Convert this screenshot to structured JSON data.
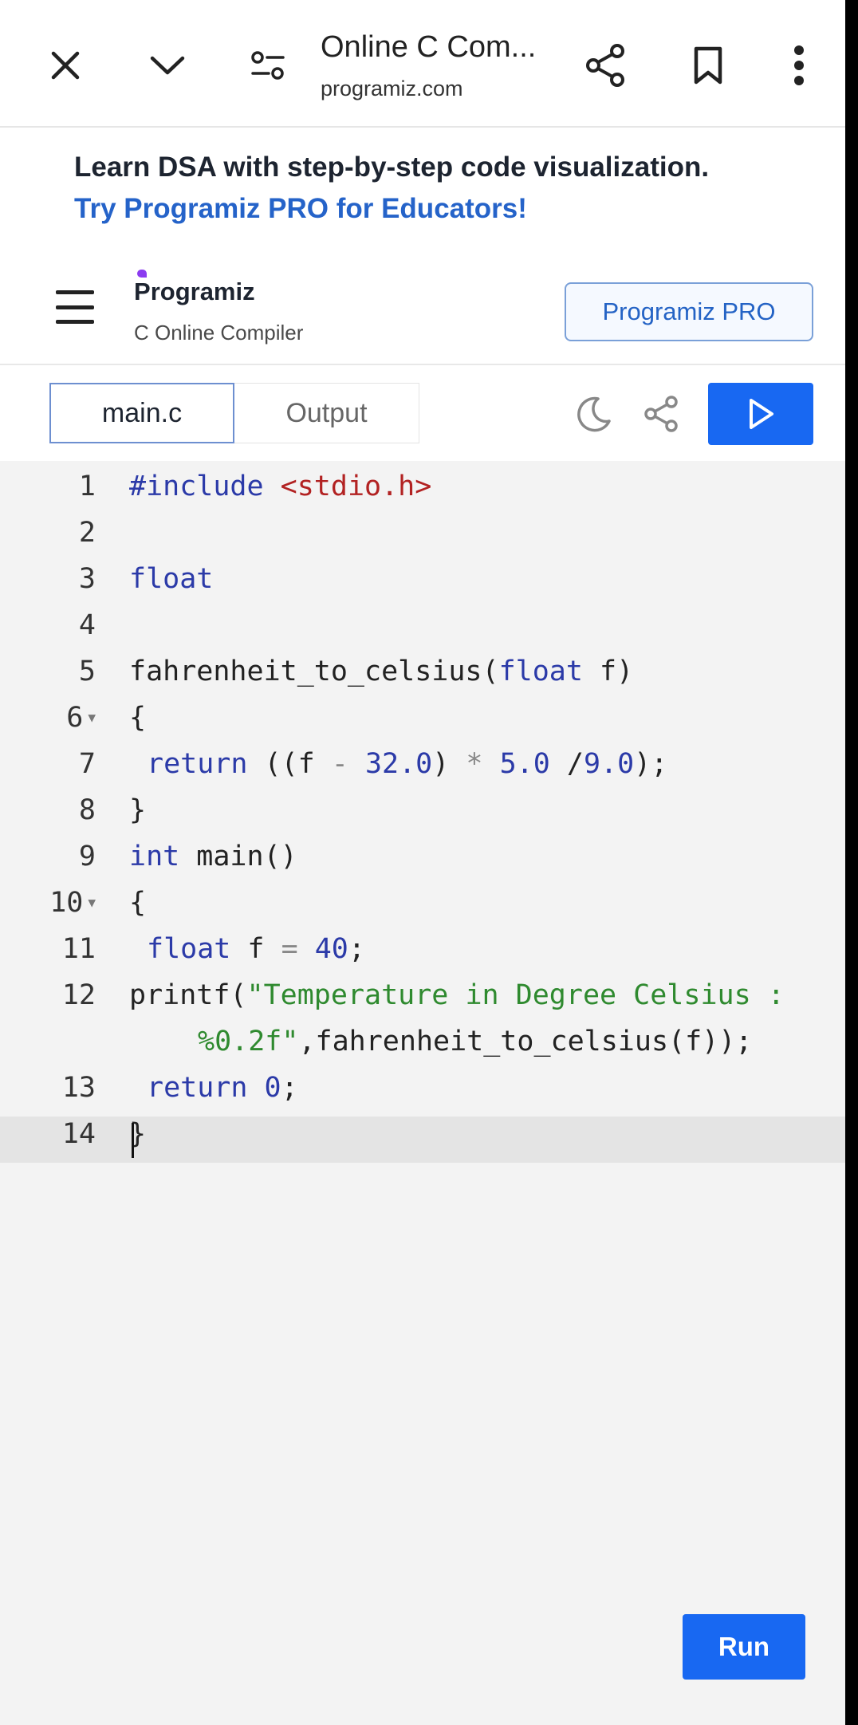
{
  "browser": {
    "title": "Online C Com...",
    "url": "programiz.com",
    "icons": [
      "close-icon",
      "chevron-down-icon",
      "site-settings-icon",
      "share-icon",
      "bookmark-icon",
      "more-vert-icon"
    ]
  },
  "promo": {
    "line1": "Learn DSA with step-by-step code visualization.",
    "line2": "Try Programiz PRO for Educators!"
  },
  "header": {
    "logo_text": "rogramiz",
    "logo_initial": "P",
    "subtitle": "C Online Compiler",
    "pro_button": "Programiz PRO"
  },
  "tabs": {
    "main": "main.c",
    "output": "Output"
  },
  "editor": {
    "lines": [
      "1",
      "2",
      "3",
      "4",
      "5",
      "6",
      "7",
      "8",
      "9",
      "10",
      "11",
      "12",
      "13",
      "14"
    ],
    "code": {
      "l1_kw": "#include",
      "l1_lib": "<stdio.h>",
      "l3": "float",
      "l5_fn": "fahrenheit_to_celsius(",
      "l5_kw": "float",
      "l5_end": " f)",
      "l6": "{",
      "l7_kw": "return",
      "l7_a": " ((f ",
      "l7_minus": "-",
      "l7_b": " ",
      "l7_n1": "32.0",
      "l7_c": ") ",
      "l7_mul": "*",
      "l7_d": " ",
      "l7_n2": "5.0",
      "l7_e": " /",
      "l7_n3": "9.0",
      "l7_f": ");",
      "l8": "}",
      "l9_kw": "int",
      "l9_rest": " main()",
      "l10": "{",
      "l11_kw": "float",
      "l11_a": " f ",
      "l11_eq": "=",
      "l11_sp": " ",
      "l11_n": "40",
      "l11_end": ";",
      "l12_fn": "printf(",
      "l12_str1": "\"Temperature in Degree Celsius :",
      "l12_str2": "%0.2f\"",
      "l12_rest": ",fahrenheit_to_celsius(f));",
      "l13_kw": "return",
      "l13_sp": " ",
      "l13_n": "0",
      "l13_end": ";",
      "l14": "}"
    }
  },
  "run_button": "Run"
}
